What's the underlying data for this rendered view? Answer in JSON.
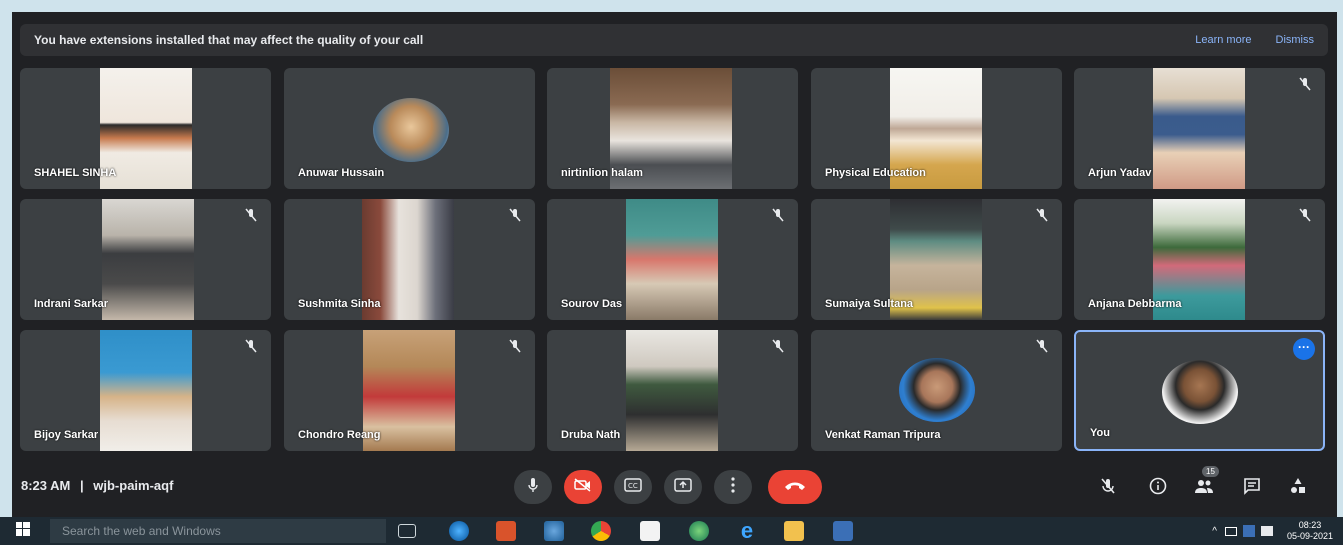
{
  "banner": {
    "message": "You have extensions installed that may affect the quality of your call",
    "learn_more": "Learn more",
    "dismiss": "Dismiss"
  },
  "participants": [
    {
      "name": "SHAHEL SINHA",
      "muted": false
    },
    {
      "name": "Anuwar Hussain",
      "muted": false
    },
    {
      "name": "nirtinlion halam",
      "muted": false
    },
    {
      "name": "Physical Education",
      "muted": false
    },
    {
      "name": "Arjun Yadav",
      "muted": true
    },
    {
      "name": "Indrani Sarkar",
      "muted": true
    },
    {
      "name": "Sushmita Sinha",
      "muted": true
    },
    {
      "name": "Sourov Das",
      "muted": true
    },
    {
      "name": "Sumaiya Sultana",
      "muted": true
    },
    {
      "name": "Anjana Debbarma",
      "muted": true
    },
    {
      "name": "Bijoy Sarkar",
      "muted": true
    },
    {
      "name": "Chondro Reang",
      "muted": true
    },
    {
      "name": "Druba Nath",
      "muted": true
    },
    {
      "name": "Venkat Raman Tripura",
      "muted": true
    },
    {
      "name": "You",
      "muted": false
    }
  ],
  "meeting": {
    "time": "8:23 AM",
    "separator": "|",
    "code": "wjb-paim-aqf"
  },
  "controls": {
    "people_count": "15"
  },
  "taskbar": {
    "search_placeholder": "Search the web and Windows",
    "time": "08:23",
    "date": "05-09-2021"
  },
  "colors": {
    "meet_bg": "#202124",
    "tile_bg": "#3c4043",
    "accent_blue": "#1a73e8",
    "end_call_red": "#ea4335",
    "link_blue": "#8ab4f8"
  }
}
